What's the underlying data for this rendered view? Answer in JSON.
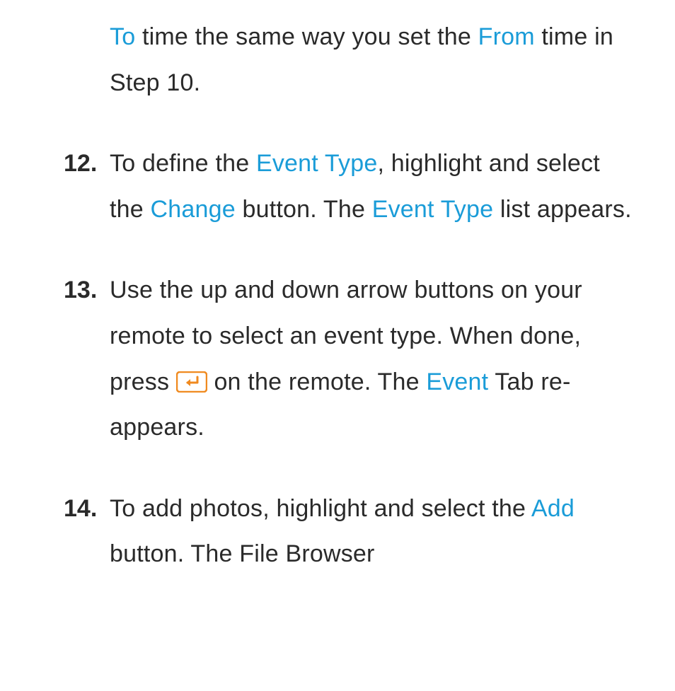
{
  "intro": {
    "part1": "To",
    "part2": " time the same way you set the ",
    "part3": "From",
    "part4": " time in Step 10."
  },
  "steps": [
    {
      "number": "12.",
      "segments": [
        {
          "text": "To define the ",
          "highlight": false
        },
        {
          "text": "Event Type",
          "highlight": true
        },
        {
          "text": ", highlight and select the ",
          "highlight": false
        },
        {
          "text": "Change",
          "highlight": true
        },
        {
          "text": " button. The ",
          "highlight": false
        },
        {
          "text": "Event Type",
          "highlight": true
        },
        {
          "text": " list appears.",
          "highlight": false
        }
      ]
    },
    {
      "number": "13.",
      "segments": [
        {
          "text": "Use the up and down arrow buttons on your remote to select an event type. When done, press ",
          "highlight": false
        },
        {
          "text": "ENTER_ICON",
          "highlight": false,
          "icon": true
        },
        {
          "text": " on the remote. The ",
          "highlight": false
        },
        {
          "text": "Event",
          "highlight": true
        },
        {
          "text": " Tab re-appears.",
          "highlight": false
        }
      ]
    },
    {
      "number": "14.",
      "segments": [
        {
          "text": "To add photos, highlight and select the ",
          "highlight": false
        },
        {
          "text": "Add",
          "highlight": true
        },
        {
          "text": " button. The File Browser",
          "highlight": false
        }
      ]
    }
  ]
}
